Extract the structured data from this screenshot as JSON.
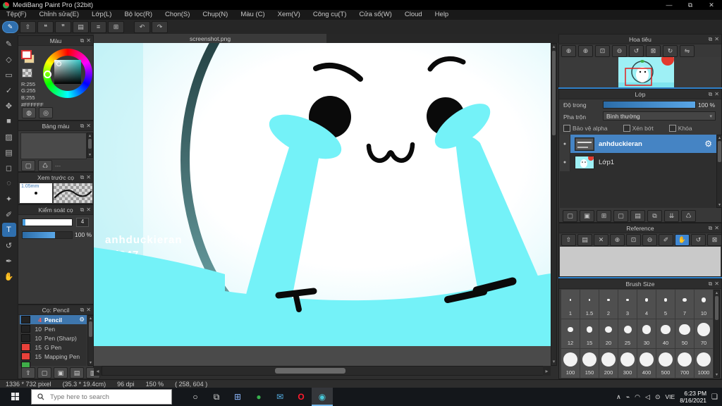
{
  "window": {
    "title": "MediBang Paint Pro (32bit)",
    "minimize": "—",
    "restore": "⧉",
    "close": "✕"
  },
  "menu": [
    "Tệp(F)",
    "Chỉnh sửa(E)",
    "Lớp(L)",
    "Bộ lọc(R)",
    "Chọn(S)",
    "Chụp(N)",
    "Màu (C)",
    "Xem(V)",
    "Công cụ(T)",
    "Cửa sổ(W)",
    "Cloud",
    "Help"
  ],
  "toolbar": {
    "buttons": [
      {
        "name": "paint-mode-button",
        "glyph": "✎",
        "active": true
      },
      {
        "name": "share-button",
        "glyph": "⇧"
      },
      {
        "name": "comment-button",
        "glyph": "❝"
      },
      {
        "name": "message-button",
        "glyph": "❞"
      },
      {
        "name": "document-button",
        "glyph": "▤"
      },
      {
        "name": "list-button",
        "glyph": "≡"
      },
      {
        "name": "grid-button",
        "glyph": "⊞"
      }
    ],
    "undo": "↶",
    "redo": "↷"
  },
  "tool_column": {
    "tools": [
      {
        "name": "brush-tool",
        "glyph": "✎"
      },
      {
        "name": "eraser-tool",
        "glyph": "◇"
      },
      {
        "name": "select-rect-tool",
        "glyph": "▭"
      },
      {
        "name": "select-pen-tool",
        "glyph": "✓"
      },
      {
        "name": "move-tool",
        "glyph": "✥"
      },
      {
        "name": "shape-tool",
        "glyph": "■"
      },
      {
        "name": "fill-tool",
        "glyph": "▨"
      },
      {
        "name": "gradient-tool",
        "glyph": "▤"
      },
      {
        "name": "select-lasso-tool",
        "glyph": "◻"
      },
      {
        "name": "select-ellipse-tool",
        "glyph": "◌"
      },
      {
        "name": "magic-wand-tool",
        "glyph": "✦"
      },
      {
        "name": "ruler-tool",
        "glyph": "✐"
      },
      {
        "name": "text-tool",
        "glyph": "T",
        "selected": true
      },
      {
        "name": "rotate-view-tool",
        "glyph": "↺"
      },
      {
        "name": "pen-tool",
        "glyph": "✒"
      },
      {
        "name": "hand-tool",
        "glyph": "✋"
      }
    ]
  },
  "color_panel": {
    "title": "Màu",
    "r": "R:255",
    "g": "G:255",
    "b": "B:255",
    "hex": "#FFFFFF",
    "fg_color": "#ffffff",
    "bg_color": "#ecd39a"
  },
  "palette_panel": {
    "title": "Bảng màu",
    "more": "---",
    "new_glyph": "▢",
    "trash_glyph": "♺"
  },
  "preview_panel": {
    "title": "Xem trước cọ",
    "size": "1.05mm"
  },
  "control_panel": {
    "title": "Kiểm soát cọ",
    "value": "4",
    "percent": "100 %"
  },
  "brush_panel": {
    "title": "Cọ: Pencil",
    "rows": [
      {
        "size": "4",
        "name": "Pencil",
        "swatch": "#222222",
        "selected": true
      },
      {
        "size": "10",
        "name": "Pen",
        "swatch": "#222222",
        "selected": false
      },
      {
        "size": "10",
        "name": "Pen (Sharp)",
        "swatch": "#222222",
        "selected": false
      },
      {
        "size": "15",
        "name": "G Pen",
        "swatch": "#e8413a",
        "selected": false
      },
      {
        "size": "15",
        "name": "Mapping Pen",
        "swatch": "#e8413a",
        "selected": false
      },
      {
        "size": "",
        "name": "",
        "swatch": "#3fae49",
        "selected": false
      }
    ],
    "buttons": [
      "⇪",
      "▢",
      "▣",
      "▤",
      "▥"
    ],
    "button_names": [
      "cloud-download-button",
      "add-brush-button",
      "duplicate-brush-button",
      "edit-brush-button",
      "folder-button"
    ]
  },
  "canvas": {
    "tab": "screenshot.png",
    "watermark1": "anhduckieran",
    "watermark2": "hd247",
    "cyan": "#74f2f8",
    "arc_dark": "#2a4547"
  },
  "navigator": {
    "title": "Hoa tiêu",
    "buttons": [
      "⊕",
      "⊕",
      "⊡",
      "⊖",
      "↺",
      "⊠",
      "↻",
      "⇋"
    ],
    "button_names": [
      "zoom-reset-button",
      "zoom-in-button",
      "fit-screen-button",
      "zoom-out-button",
      "rotate-left-button",
      "rotate-reset-button",
      "rotate-right-button",
      "flip-button"
    ]
  },
  "layer_panel": {
    "title": "Lớp",
    "opacity_label": "Độ trong",
    "opacity_value": "100 %",
    "blend_label": "Pha trộn",
    "blend_value": "Bình thường",
    "checkboxes": [
      "Bảo vệ alpha",
      "Xén bớt",
      "Khóa"
    ],
    "layers": [
      {
        "name": "anhduckieran",
        "selected": true
      },
      {
        "name": "Lớp1",
        "selected": false
      }
    ],
    "buttons": [
      "▢",
      "▣",
      "⊞",
      "▢",
      "▤",
      "⧉",
      "⇊",
      "♺"
    ],
    "button_names": [
      "new-layer-button",
      "new-8bit-layer-button",
      "new-1bit-layer-button",
      "add-layer-menu-button",
      "layer-folder-button",
      "duplicate-layer-button",
      "merge-layer-button",
      "delete-layer-button"
    ]
  },
  "reference_panel": {
    "title": "Reference",
    "buttons": [
      "⇧",
      "▤",
      "✕",
      "⊕",
      "⊡",
      "⊖",
      "✐",
      "✋",
      "↺",
      "⊠",
      "↻",
      "⇋"
    ],
    "button_names": [
      "open-image-button",
      "folder-button",
      "clear-button",
      "zoom-in-button",
      "fit-button",
      "zoom-out-button",
      "picker-button",
      "hand-button",
      "rotate-left-button",
      "rotate-reset-button",
      "rotate-right-button",
      "flip-button"
    ],
    "active_index": 7
  },
  "brush_size_panel": {
    "title": "Brush Size",
    "sizes": [
      "1",
      "1.5",
      "2",
      "3",
      "4",
      "5",
      "7",
      "10",
      "12",
      "15",
      "20",
      "25",
      "30",
      "40",
      "50",
      "70",
      "100",
      "150",
      "200",
      "300",
      "400",
      "500",
      "700",
      "1000"
    ]
  },
  "status_bar": {
    "segments": [
      "1336 * 732 pixel",
      "(35.3 * 19.4cm)",
      "96 dpi",
      "150 %",
      "( 258, 604 )"
    ]
  },
  "taskbar": {
    "search_placeholder": "Type here to search",
    "apps": [
      {
        "name": "cortana-icon",
        "glyph": "○",
        "color": "#e8e8e8",
        "active": false
      },
      {
        "name": "task-view-icon",
        "glyph": "⧉",
        "color": "#dcdcdc",
        "active": false
      },
      {
        "name": "store-icon",
        "glyph": "⊞",
        "color": "#8ab4f8",
        "active": false
      },
      {
        "name": "coccoc-icon",
        "glyph": "●",
        "color": "#37b24d",
        "active": false
      },
      {
        "name": "mail-icon",
        "glyph": "✉",
        "color": "#56b2e8",
        "active": false
      },
      {
        "name": "opera-icon",
        "glyph": "O",
        "color": "#ff1b2d",
        "active": false
      },
      {
        "name": "medibang-icon",
        "glyph": "◉",
        "color": "#49c8d8",
        "active": true
      }
    ],
    "tray_icons": [
      {
        "name": "hidden-icons-chevron",
        "glyph": "∧"
      },
      {
        "name": "battery-icon",
        "glyph": "⌁"
      },
      {
        "name": "wifi-icon",
        "glyph": "◠"
      },
      {
        "name": "volume-icon",
        "glyph": "◁"
      },
      {
        "name": "update-icon",
        "glyph": "⊙"
      }
    ],
    "language": "VIE",
    "time": "6:23 PM",
    "date": "8/16/2021",
    "action_center_glyph": "❏"
  }
}
